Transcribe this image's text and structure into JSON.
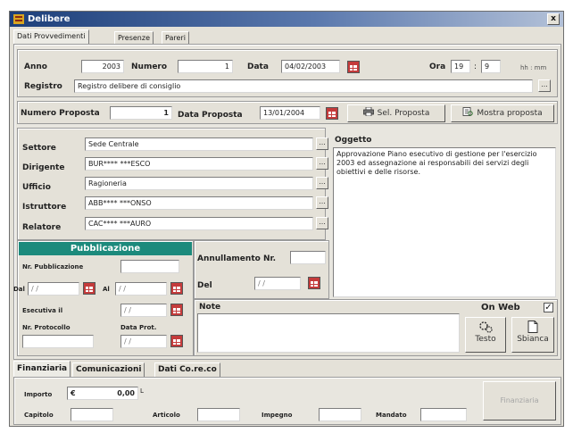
{
  "window": {
    "title": "Delibere",
    "close": "x"
  },
  "tabs": [
    "Dati Provvedimenti",
    "Presenze",
    "Pareri"
  ],
  "header": {
    "anno_label": "Anno",
    "anno_value": "2003",
    "numero_label": "Numero",
    "numero_value": "1",
    "data_label": "Data",
    "data_value": "04/02/2003",
    "ora_label": "Ora",
    "ora_h": "19",
    "ora_sep": ":",
    "ora_m": "9",
    "ora_unit": "hh : mm",
    "registro_label": "Registro",
    "registro_value": "Registro delibere di consiglio",
    "lookup": "..."
  },
  "proposta": {
    "numero_label": "Numero Proposta",
    "numero_value": "1",
    "data_label": "Data Proposta",
    "data_value": "13/01/2004",
    "sel_button": "Sel. Proposta",
    "mostra_button": "Mostra proposta"
  },
  "people": [
    {
      "label": "Settore",
      "value": "Sede Centrale"
    },
    {
      "label": "Dirigente",
      "value": "BUR**** ***ESCO"
    },
    {
      "label": "Ufficio",
      "value": "Ragioneria"
    },
    {
      "label": "Istruttore",
      "value": "ABB**** ***ONSO"
    },
    {
      "label": "Relatore",
      "value": "CAC**** ***AURO"
    }
  ],
  "oggetto": {
    "label": "Oggetto",
    "text": "Approvazione Piano esecutivo di gestione per l'esercizio 2003 ed assegnazione ai responsabili dei servizi degli obiettivi e delle risorse."
  },
  "pubblicazione": {
    "title": "Pubblicazione",
    "nr_label": "Nr. Pubblicazione",
    "nr_value": "",
    "dal_label": "Dal",
    "dal_value": "/ /",
    "al_label": "Al",
    "al_value": "/ /",
    "esecutiva_label": "Esecutiva il",
    "esecutiva_value": "/ /",
    "protocollo_label": "Nr. Protocollo",
    "protocollo_value": "",
    "data_prot_label": "Data Prot.",
    "data_prot_value": "/ /"
  },
  "annullamento": {
    "label": "Annullamento Nr.",
    "value": "",
    "del_label": "Del",
    "del_value": "/ /"
  },
  "note": {
    "label": "Note",
    "value": ""
  },
  "web": {
    "label": "On Web",
    "checked": "✓",
    "testo_button": "Testo",
    "bianca_button": "Sbianca"
  },
  "bottom_tabs": [
    "Finanziaria",
    "Comunicazioni",
    "Dati Co.re.co"
  ],
  "finanziaria": {
    "importo_label": "Importo",
    "currency": "€",
    "importo_value": "0,00",
    "importo_unit": "L",
    "capitolo_label": "Capitolo",
    "articolo_label": "Articolo",
    "impegno_label": "Impegno",
    "mandato_label": "Mandato",
    "finanziaria_button": "Finanziaria"
  }
}
